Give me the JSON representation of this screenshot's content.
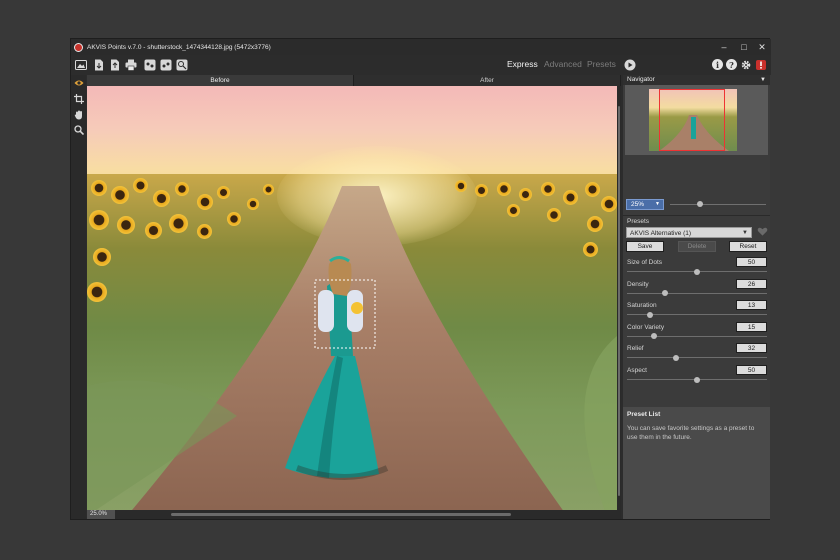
{
  "window": {
    "title": "AKVIS Points v.7.0 - shutterstock_1474344128.jpg (5472x3776)",
    "controls": [
      "minimize-icon",
      "maximize-icon",
      "close-icon"
    ]
  },
  "toolbar": {
    "left_icons": [
      "home-icon",
      "open-file-icon",
      "save-file-icon",
      "print-icon",
      "import-preset-icon",
      "export-preset-icon",
      "share-icon"
    ],
    "modes": {
      "express": "Express",
      "advanced": "Advanced",
      "presets": "Presets"
    },
    "active_mode": "Express",
    "run_icon": "play-icon",
    "right_icons": {
      "info": "i",
      "help": "?",
      "settings": "gear-icon",
      "notifications": "notification-icon"
    }
  },
  "left_tools": [
    "eye-icon",
    "crop-icon",
    "hand-icon",
    "zoom-icon"
  ],
  "canvas": {
    "tabs": {
      "before": "Before",
      "after": "After"
    },
    "active_tab": "Before",
    "zoom_badge": "25.0%"
  },
  "navigator": {
    "title": "Navigator",
    "zoom_value": "25%",
    "zoom_slider_fraction": 0.3
  },
  "presets": {
    "title": "Presets",
    "selected": "AKVIS Alternative (1)",
    "favorite_icon": "heart-icon",
    "buttons": {
      "save": "Save",
      "delete": "Delete",
      "reset": "Reset"
    }
  },
  "parameters": [
    {
      "label": "Size of Dots",
      "value": "50",
      "fraction": 0.5
    },
    {
      "label": "Density",
      "value": "26",
      "fraction": 0.26
    },
    {
      "label": "Saturation",
      "value": "13",
      "fraction": 0.15
    },
    {
      "label": "Color Variety",
      "value": "15",
      "fraction": 0.18
    },
    {
      "label": "Relief",
      "value": "32",
      "fraction": 0.34
    },
    {
      "label": "Aspect",
      "value": "50",
      "fraction": 0.5
    }
  ],
  "preset_list": {
    "title": "Preset List",
    "text": "You can save favorite settings as a preset to use them in the future."
  }
}
